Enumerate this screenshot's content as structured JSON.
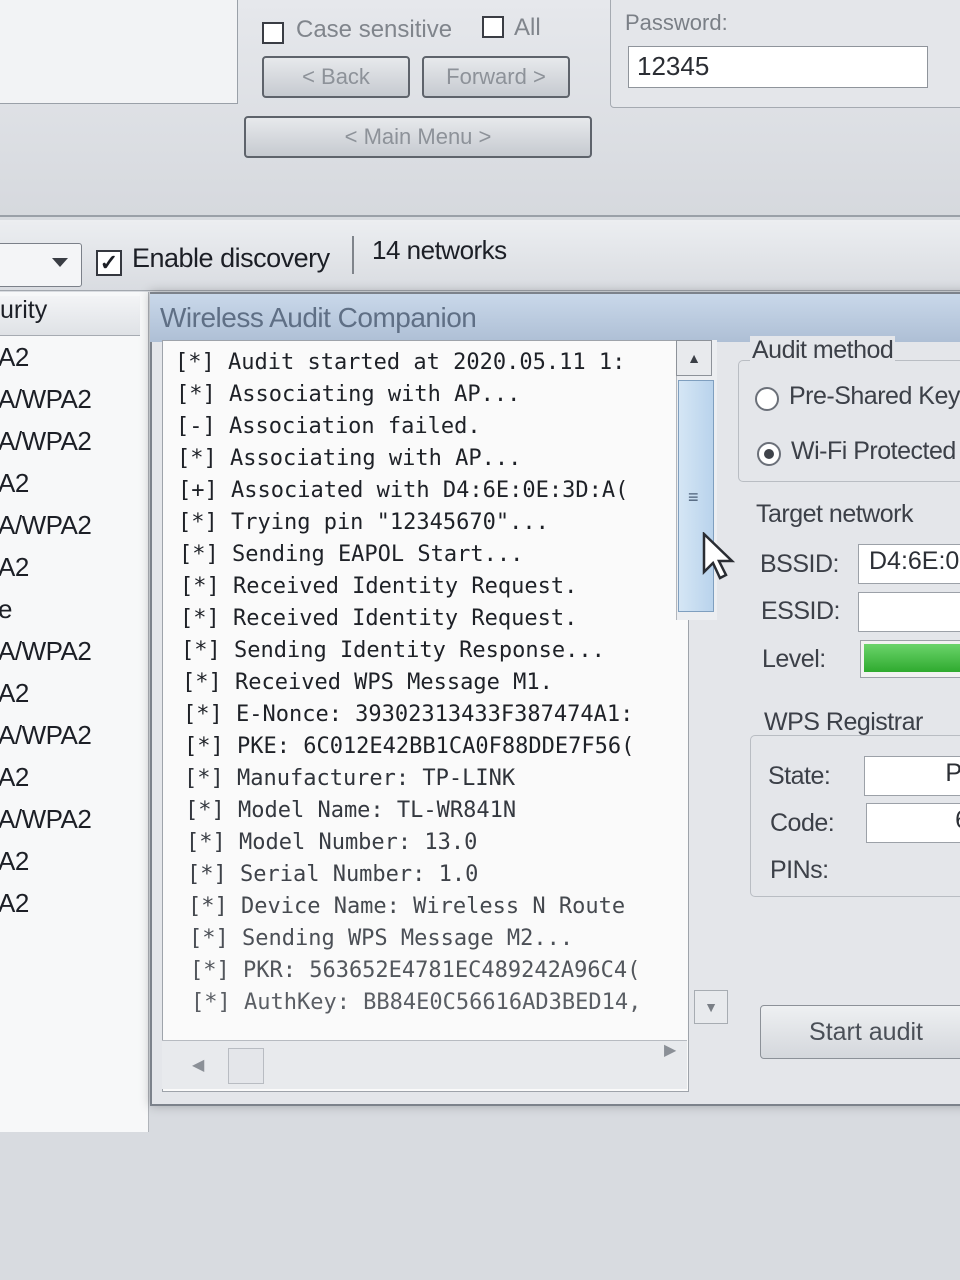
{
  "top": {
    "case_sensitive_label": "Case sensitive",
    "all_label": "All",
    "back_label": "< Back",
    "forward_label": "Forward >",
    "main_menu_label": "< Main Menu >",
    "password_label": "Password:",
    "password_value": "12345"
  },
  "toolbar": {
    "enable_discovery_label": "Enable discovery",
    "enable_discovery_checked": true,
    "network_count": "14 networks"
  },
  "network_list": {
    "header": "urity",
    "rows": [
      "A2",
      "A/WPA2",
      "A/WPA2",
      "A2",
      "A/WPA2",
      "A2",
      "e",
      "A/WPA2",
      "A2",
      "A/WPA2",
      "A2",
      "A/WPA2",
      "A2",
      "A2"
    ]
  },
  "dialog": {
    "title": "Wireless Audit Companion",
    "log": [
      "[*] Audit started at 2020.05.11 1:",
      "[*] Associating with AP...",
      "[-] Association failed.",
      "[*] Associating with AP...",
      "[+] Associated with D4:6E:0E:3D:A(",
      "[*] Trying pin \"12345670\"...",
      "[*] Sending EAPOL Start...",
      "[*] Received Identity Request.",
      "[*] Received Identity Request.",
      "[*] Sending Identity Response...",
      "[*] Received WPS Message M1.",
      "[*] E-Nonce: 39302313433F387474A1:",
      "[*] PKE: 6C012E42BB1CA0F88DDE7F56(",
      "[*] Manufacturer: TP-LINK",
      "[*] Model Name: TL-WR841N",
      "[*] Model Number: 13.0",
      "[*] Serial Number: 1.0",
      "[*] Device Name: Wireless N Route",
      "[*] Sending WPS Message M2...",
      "[*] PKR: 563652E4781EC489242A96C4(",
      "[*] AuthKey: BB84E0C56616AD3BED14,"
    ],
    "audit_method": {
      "title": "Audit method",
      "option_psk": "Pre-Shared Key",
      "option_wps": "Wi-Fi Protected",
      "selected": "wps"
    },
    "target_network": {
      "title": "Target network",
      "bssid_label": "BSSID:",
      "bssid_value": "D4:6E:0",
      "essid_label": "ESSID:",
      "essid_value": "",
      "level_label": "Level:"
    },
    "wps_registrar": {
      "title": "WPS Registrar",
      "state_label": "State:",
      "state_value": "PI",
      "code_label": "Code:",
      "code_value": "6",
      "pins_label": "PINs:"
    },
    "start_button": "Start audit"
  }
}
